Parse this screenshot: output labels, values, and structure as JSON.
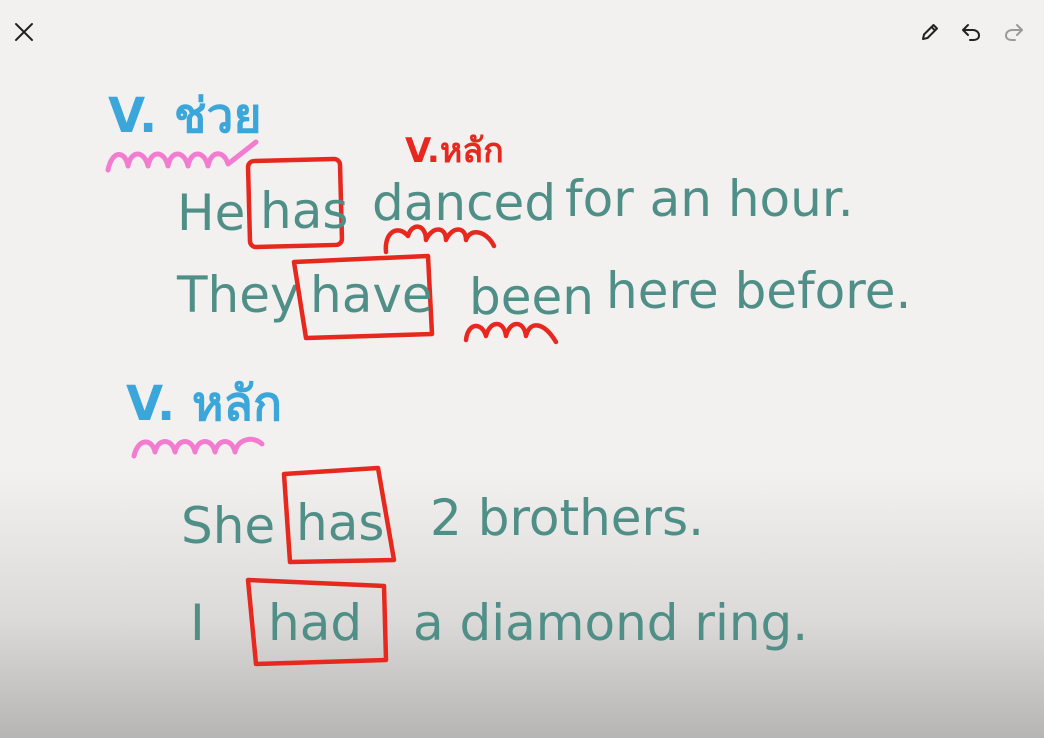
{
  "toolbar": {
    "close_icon": "close-icon",
    "pen_icon": "pen-icon",
    "undo_icon": "undo-icon",
    "redo_icon": "redo-icon"
  },
  "colors": {
    "handwriting_teal": "#4f8f87",
    "heading_blue": "#3aa6da",
    "annotation_red": "#e6281e",
    "underline_pink": "#f27cd0",
    "background": "#f3f1ef"
  },
  "whiteboard": {
    "heading_helper": "V. ช่วย",
    "annotation_main": "V.หลัก",
    "sentence_1": {
      "subject": "He",
      "boxed": "has",
      "rest_1": "danced",
      "rest_2": "for an hour."
    },
    "sentence_2": {
      "subject": "They",
      "boxed": "have",
      "rest_1": "been",
      "rest_2": "here before."
    },
    "heading_main": "V. หลัก",
    "sentence_3": {
      "subject": "She",
      "boxed": "has",
      "rest": "2 brothers."
    },
    "sentence_4": {
      "subject": "I",
      "boxed": "had",
      "rest": "a diamond ring."
    }
  }
}
